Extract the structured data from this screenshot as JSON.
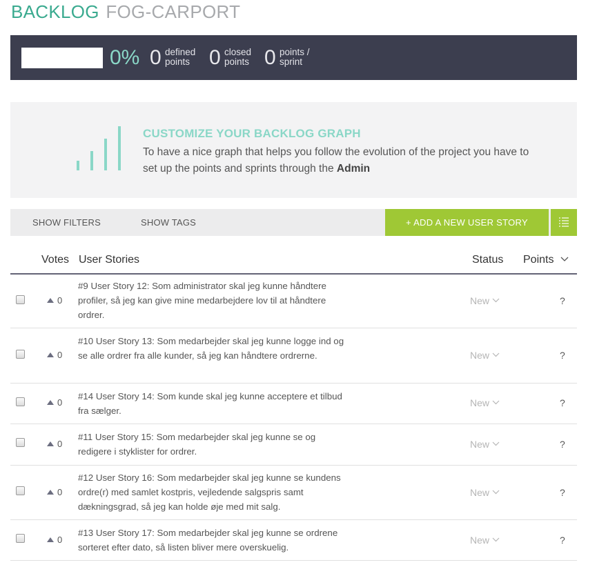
{
  "header": {
    "title_main": "BACKLOG",
    "title_project": "FOG-CARPORT"
  },
  "summary": {
    "percent": "0%",
    "stats": [
      {
        "value": "0",
        "label_line1": "defined",
        "label_line2": "points"
      },
      {
        "value": "0",
        "label_line1": "closed",
        "label_line2": "points"
      },
      {
        "value": "0",
        "label_line1": "points /",
        "label_line2": "sprint"
      }
    ]
  },
  "promo": {
    "title": "CUSTOMIZE YOUR BACKLOG GRAPH",
    "text": "To have a nice graph that helps you follow the evolution of the project you have to set up the points and sprints through the ",
    "text_bold": "Admin"
  },
  "toolbar": {
    "show_filters": "SHOW FILTERS",
    "show_tags": "SHOW TAGS",
    "add_story": "+ ADD A NEW USER STORY"
  },
  "table": {
    "headers": {
      "votes": "Votes",
      "stories": "User Stories",
      "status": "Status",
      "points": "Points"
    },
    "rows": [
      {
        "votes": "0",
        "story": "#9 User Story 12: Som administrator skal jeg kunne håndtere profiler, så jeg kan give mine medarbejdere lov til at håndtere ordrer.",
        "status": "New",
        "points": "?"
      },
      {
        "votes": "0",
        "story": "#10 User Story 13: Som medarbejder skal jeg kunne logge ind og se alle ordrer fra alle kunder, så jeg kan håndtere ordrerne.",
        "status": "New",
        "points": "?"
      },
      {
        "votes": "0",
        "story": "#14 User Story 14: Som kunde skal jeg kunne acceptere et tilbud fra sælger.",
        "status": "New",
        "points": "?"
      },
      {
        "votes": "0",
        "story": "#11 User Story 15: Som medarbejder skal jeg kunne se og redigere i styklister for ordrer.",
        "status": "New",
        "points": "?"
      },
      {
        "votes": "0",
        "story": "#12 User Story 16: Som medarbejder skal jeg kunne se kundens ordre(r) med samlet kostpris, vejledende salgspris samt dækningsgrad, så jeg kan holde øje med mit salg.",
        "status": "New",
        "points": "?"
      },
      {
        "votes": "0",
        "story": "#13 User Story 17: Som medarbejder skal jeg kunne se ordrene sorteret efter dato, så listen bliver mere overskuelig.",
        "status": "New",
        "points": "?"
      }
    ]
  },
  "colors": {
    "accent": "#3aaa8f",
    "mint": "#8ad7c7",
    "green_button": "#9fc835",
    "dark_bar": "#3c3e4f"
  },
  "icons": {
    "list": "list-icon",
    "chevron": "chevron-down-icon",
    "vote": "vote-up-icon"
  }
}
